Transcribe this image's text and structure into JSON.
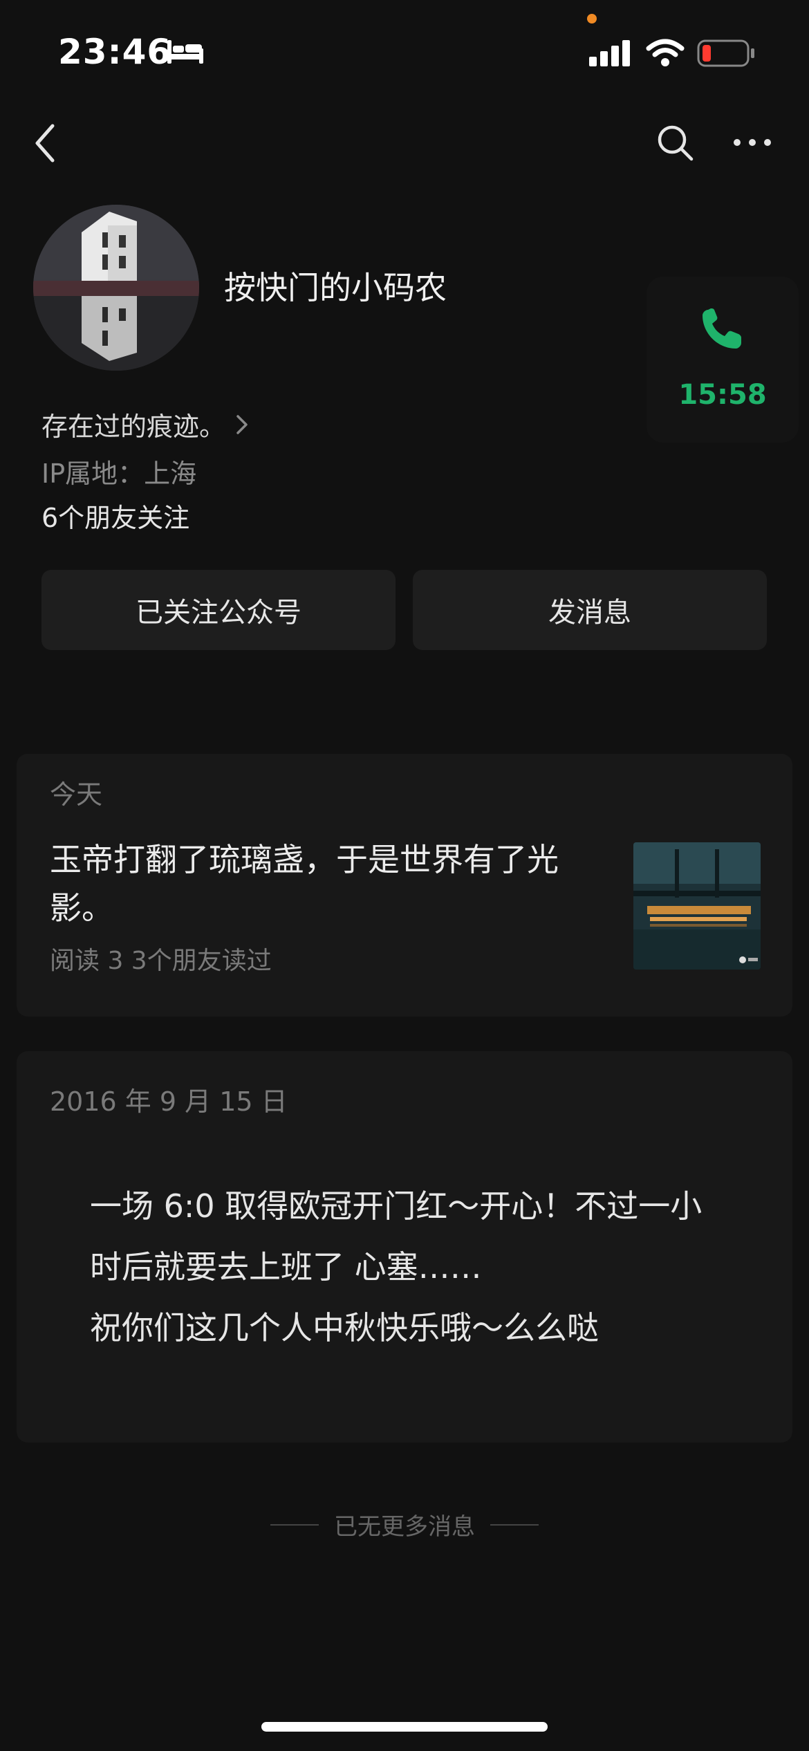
{
  "status_bar": {
    "time": "23:46",
    "icons": [
      "bed-icon",
      "signal-icon",
      "wifi-icon",
      "battery-low-icon"
    ]
  },
  "nav": {
    "back_icon": "chevron-left-icon",
    "search_icon": "search-icon",
    "more_icon": "more-icon"
  },
  "profile": {
    "name": "按快门的小码农",
    "bio": "存在过的痕迹。",
    "ip_location": "IP属地：上海",
    "friends_following": "6个朋友关注"
  },
  "call_card": {
    "icon": "phone-icon",
    "duration": "15:58",
    "accent_color": "#1fb36b"
  },
  "actions": {
    "followed_label": "已关注公众号",
    "message_label": "发消息"
  },
  "feed": {
    "today_label": "今天",
    "article_title": "玉帝打翻了琉璃盏，于是世界有了光影。",
    "article_meta": "阅读 3   3个朋友读过",
    "old_date": "2016 年 9 月 15 日",
    "old_lines": [
      "一场 6:0 取得欧冠开门红～开心！不过一小",
      "时后就要去上班了 心塞……",
      "祝你们这几个人中秋快乐哦～么么哒"
    ]
  },
  "footer": {
    "no_more": "已无更多消息"
  }
}
